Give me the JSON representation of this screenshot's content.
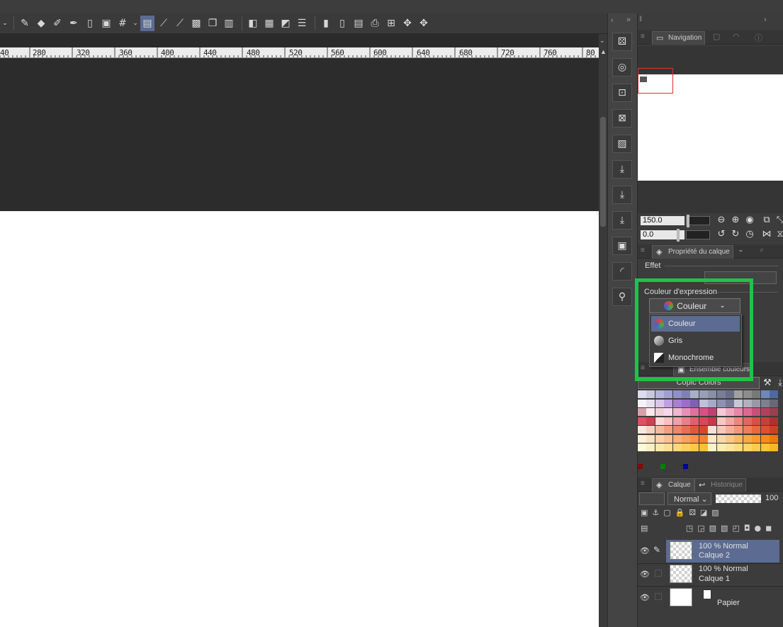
{
  "ruler": {
    "labels": [
      "40",
      "280",
      "320",
      "360",
      "400",
      "440",
      "480",
      "520",
      "560",
      "600",
      "640",
      "680",
      "720",
      "760",
      "80"
    ]
  },
  "toolbar": {
    "icons": [
      "pen-icon",
      "eraser-icon",
      "pencil-icon",
      "pen-alt-icon",
      "frame-icon",
      "frame-center-icon",
      "grid-icon",
      "ruler-icon",
      "brush-icon",
      "brush-alt-icon",
      "select-icon",
      "copy-icon",
      "paste-icon",
      "layer-icon",
      "layer-alt-icon",
      "transform-icon",
      "flip-icon",
      "page-icon",
      "page-alt-icon",
      "export-icon",
      "print-icon",
      "special-icon",
      "special-alt-icon"
    ]
  },
  "navigation": {
    "tab_label": "Navigation",
    "zoom_value": "150.0",
    "rotation_value": "0.0"
  },
  "layer_property": {
    "tab_label": "Propriété du calque",
    "effect_label": "Effet",
    "expression_color_label": "Couleur d'expression",
    "dropdown_selected": "Couleur",
    "options": [
      "Couleur",
      "Gris",
      "Monochrome"
    ]
  },
  "color_set": {
    "tab_label": "Ensemble couleurs",
    "set_name": "Copic Colors",
    "colors": {
      "row0": [
        "#dcdcec",
        "#c8c8e0",
        "#b4b4d8",
        "#a0a0d0",
        "#9090c4",
        "#8080b8",
        "#a8b0c8",
        "#98a0b8",
        "#8890a8",
        "#787e98",
        "#686e88",
        "#a0a0a0",
        "#8c8c8c",
        "#787878",
        "#7088b8",
        "#5068a0"
      ],
      "row1": [
        "#f4f4f8",
        "#e8e0f0",
        "#d8c8e8",
        "#c0a0e0",
        "#a880d0",
        "#9870c8",
        "#8060b0",
        "#c0c0d8",
        "#a8a8c8",
        "#9090b0",
        "#787898",
        "#c8c8d4",
        "#b0b0c0",
        "#9898a8",
        "#808090",
        "#686878"
      ],
      "row2": [
        "#d8a0a8",
        "#f8e8ec",
        "#f0d0d8",
        "#f8d8e8",
        "#f0b8d0",
        "#e890b8",
        "#e070a0",
        "#d85088",
        "#c04070",
        "#f8c8d8",
        "#f0a8c0",
        "#e888a8",
        "#e06890",
        "#c85078",
        "#b04060",
        "#984050"
      ],
      "row3": [
        "#e05060",
        "#d04050",
        "#f8d8d8",
        "#f8c0c0",
        "#f0a0a8",
        "#e88088",
        "#e06070",
        "#d84858",
        "#c83848",
        "#f8c8c0",
        "#f0a8a0",
        "#e88880",
        "#e06860",
        "#d85048",
        "#c84038",
        "#b03030"
      ],
      "row4": [
        "#fce8e0",
        "#f8d0c0",
        "#f4b8a0",
        "#f0a080",
        "#ec8868",
        "#e87050",
        "#e05838",
        "#d84828",
        "#fce0d8",
        "#f8c8b8",
        "#f4b098",
        "#f09878",
        "#ec8058",
        "#e86840",
        "#e05030",
        "#d04020"
      ],
      "row5": [
        "#fcf0d8",
        "#fce0c0",
        "#fcd0a8",
        "#fcc090",
        "#fcb078",
        "#fca060",
        "#fc9048",
        "#fc8030",
        "#fce8c8",
        "#fcd8a8",
        "#fcc888",
        "#fcb868",
        "#fca848",
        "#fc9830",
        "#fc8818",
        "#f07808"
      ],
      "row6": [
        "#fcf8d8",
        "#fcf0c0",
        "#fce8a8",
        "#fce090",
        "#fcd878",
        "#fcd060",
        "#fcc848",
        "#fcc030",
        "#fcf4c8",
        "#fcecb0",
        "#fce498",
        "#fcdc80",
        "#fcd468",
        "#fccc50",
        "#fcc438",
        "#f4b820"
      ],
      "bottom_marks": [
        "#8b0000",
        "#008000",
        "#0000a0"
      ]
    }
  },
  "layers": {
    "tab_label": "Calque",
    "history_label": "Historique",
    "blend_mode": "Normal",
    "opacity": "100",
    "items": [
      {
        "meta": "100 % Normal",
        "name": "Calque 2"
      },
      {
        "meta": "100 % Normal",
        "name": "Calque 1"
      },
      {
        "meta": "",
        "name": "Papier"
      }
    ]
  },
  "colors": {
    "accent_select": "#5c6b92",
    "highlight_box": "#1fc347",
    "canvas_bg": "#2c2c2c",
    "paper": "#ffffff"
  }
}
